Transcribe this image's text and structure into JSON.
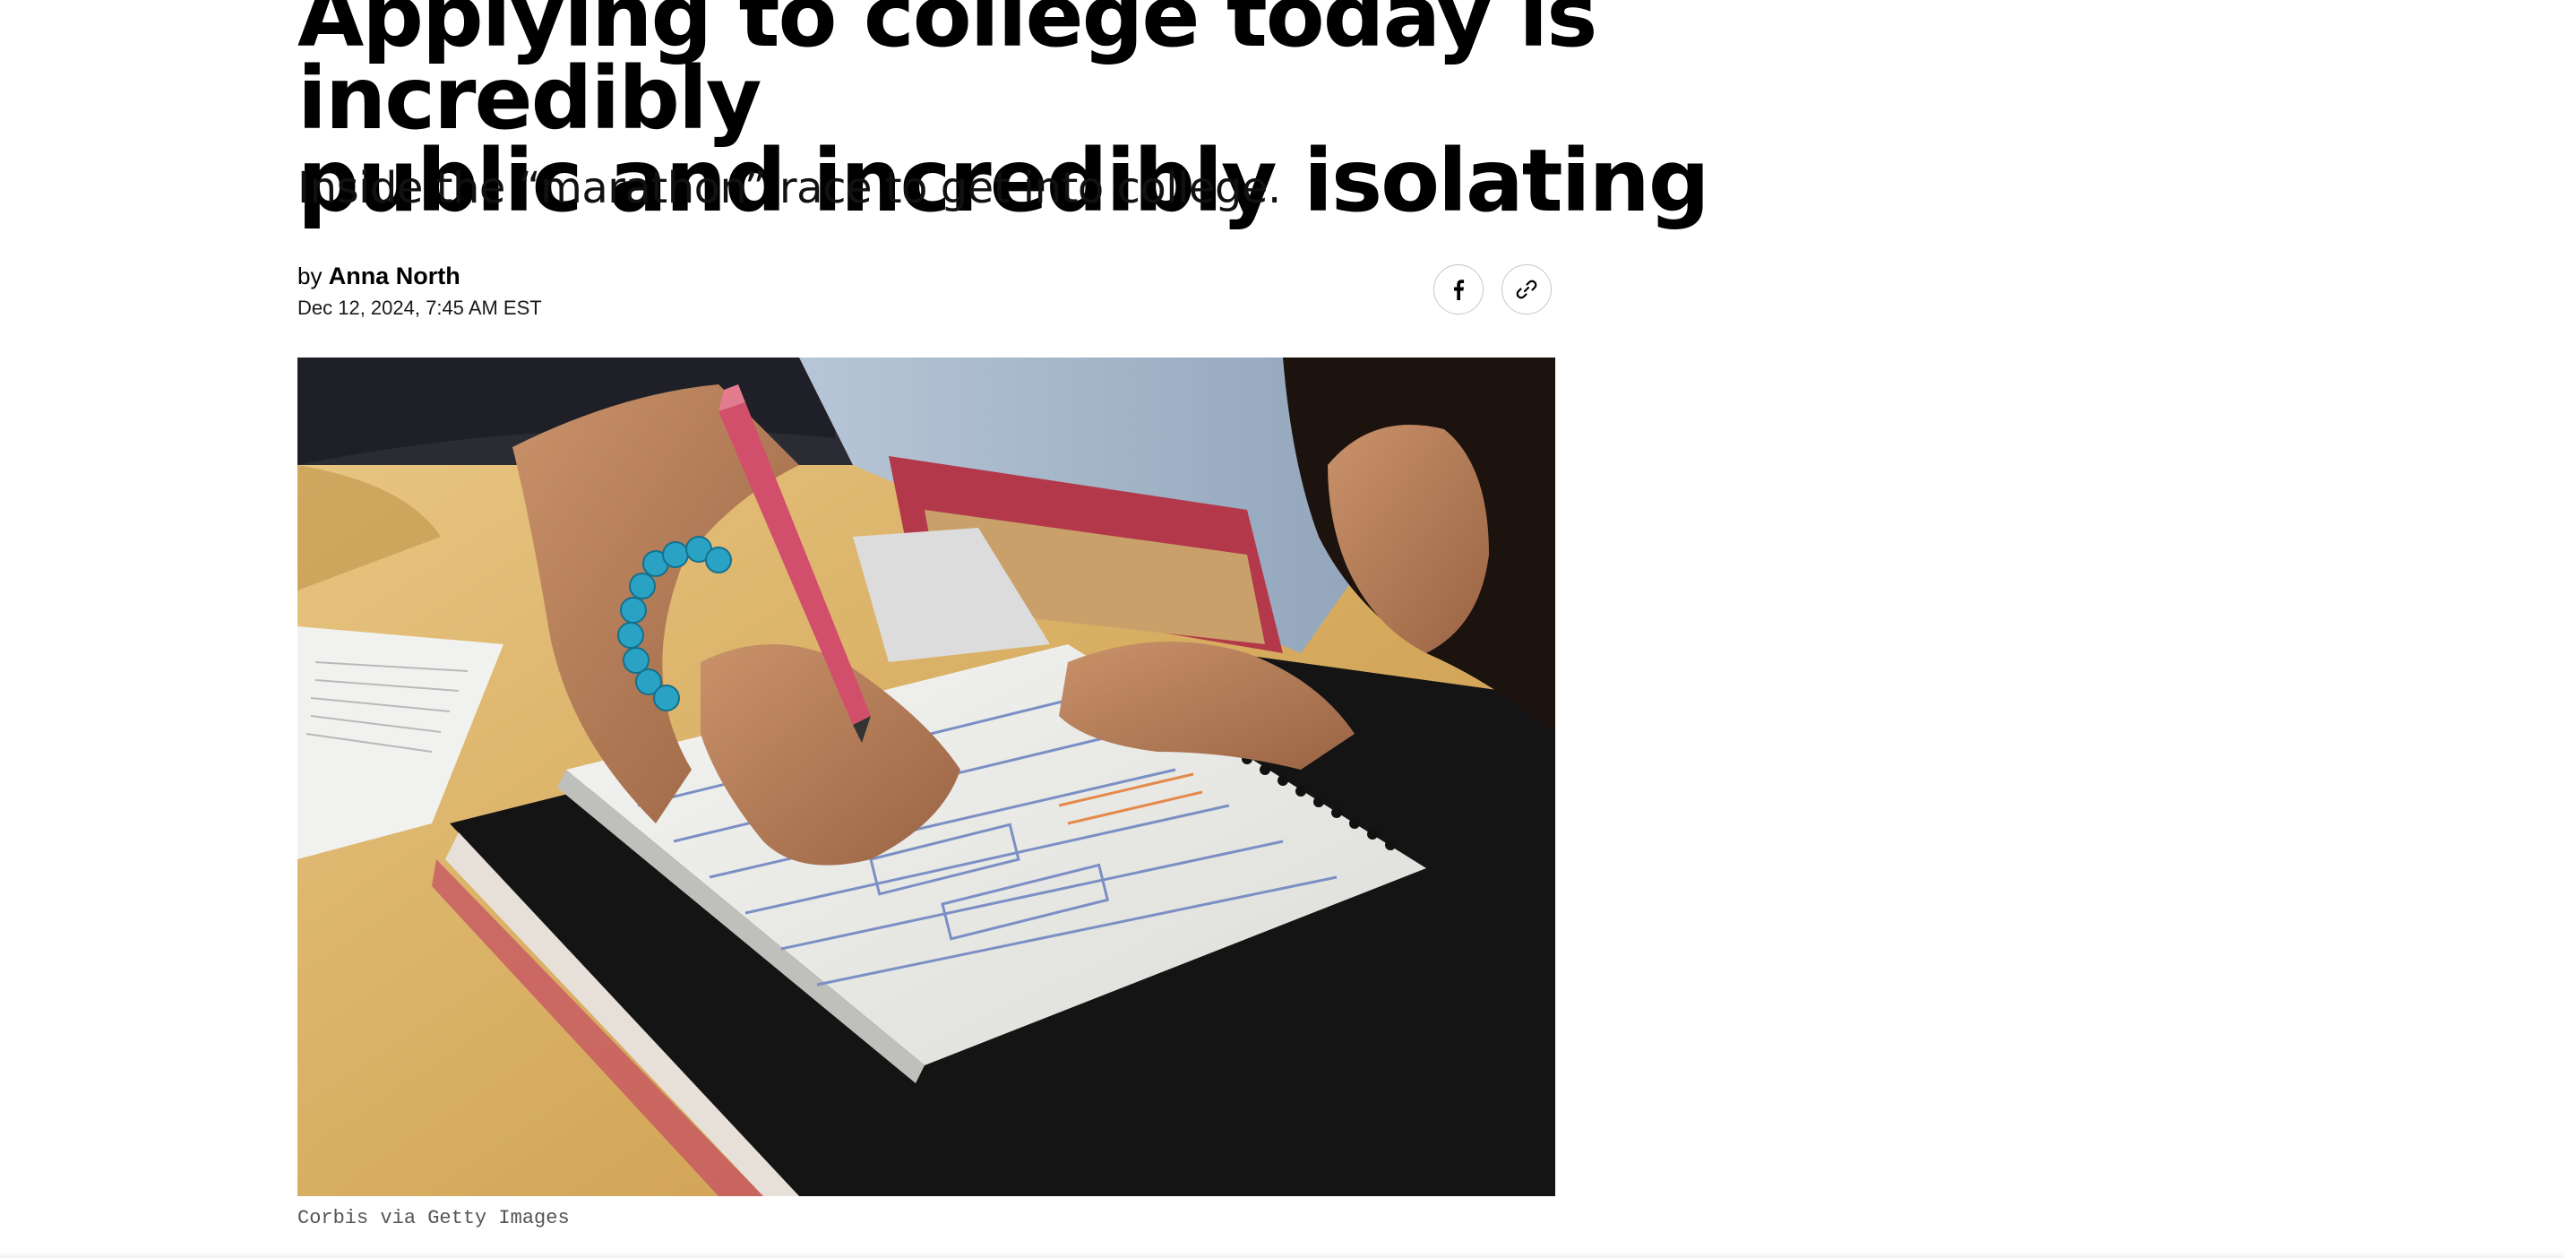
{
  "article": {
    "headline": "Applying to college today is incredibly\npublic and incredibly isolating",
    "dek": "Inside the “marathon” race to get into college.",
    "byline": {
      "prefix": "by",
      "author": "Anna North"
    },
    "timestamp": "Dec 12, 2024, 7:45 AM EST"
  },
  "share": {
    "facebook_icon": "facebook-icon",
    "link_icon": "link-icon"
  },
  "hero_image": {
    "caption": "Corbis via Getty Images"
  },
  "colors": {
    "text": "#000000",
    "share_border": "#c8c8c8",
    "caption": "#555555"
  }
}
